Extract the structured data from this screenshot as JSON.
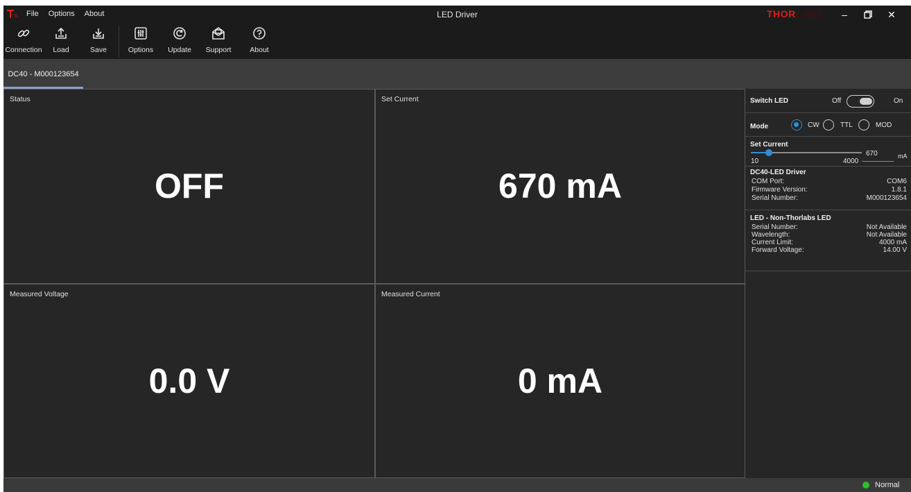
{
  "window": {
    "title": "LED Driver",
    "brand_bright": "THOR",
    "brand_dim": "LABS",
    "menu": [
      "File",
      "Options",
      "About"
    ],
    "controls": {
      "minimize": "–",
      "maximize": "🗗",
      "close": "✕"
    }
  },
  "toolbar": [
    {
      "label": "Connection",
      "icon": "link-icon"
    },
    {
      "label": "Load",
      "icon": "upload-icon"
    },
    {
      "label": "Save",
      "icon": "download-icon"
    },
    {
      "label": "Options",
      "icon": "settings-panel-icon"
    },
    {
      "label": "Update",
      "icon": "refresh-icon"
    },
    {
      "label": "Support",
      "icon": "mail-icon"
    },
    {
      "label": "About",
      "icon": "help-icon"
    }
  ],
  "tabs": [
    {
      "label": "DC40 - M000123654",
      "active": true
    }
  ],
  "panels": {
    "status": {
      "title": "Status",
      "value": "OFF"
    },
    "set_current": {
      "title": "Set Current",
      "value": "670 mA"
    },
    "measured_voltage": {
      "title": "Measured Voltage",
      "value": "0.0 V"
    },
    "measured_current": {
      "title": "Measured Current",
      "value": "0 mA"
    }
  },
  "side": {
    "switch": {
      "label": "Switch LED",
      "off": "Off",
      "on": "On",
      "state": false
    },
    "mode": {
      "label": "Mode",
      "options": [
        "CW",
        "TTL",
        "MOD"
      ],
      "selected": "CW"
    },
    "set_current": {
      "label": "Set Current",
      "min": "10",
      "max": "4000",
      "value": "670",
      "unit": "mA",
      "fraction": 0.165
    },
    "driver": {
      "heading": "DC40-LED Driver",
      "rows": [
        {
          "k": "COM Port:",
          "v": "COM6"
        },
        {
          "k": "Firmware Version:",
          "v": "1.8.1"
        },
        {
          "k": "Serial Number:",
          "v": "M000123654"
        }
      ]
    },
    "led": {
      "heading": "LED - Non-Thorlabs LED",
      "rows": [
        {
          "k": "Serial Number:",
          "v": "Not Available"
        },
        {
          "k": "Wavelength:",
          "v": "Not Available"
        },
        {
          "k": "Current Limit:",
          "v": "4000 mA"
        },
        {
          "k": "Forward Voltage:",
          "v": "14.00 V"
        }
      ]
    }
  },
  "status_bar": {
    "text": "Normal",
    "indicator_color": "#2bbf2b"
  },
  "colors": {
    "accent": "#2f8fd6",
    "brand": "#d81e1e"
  }
}
